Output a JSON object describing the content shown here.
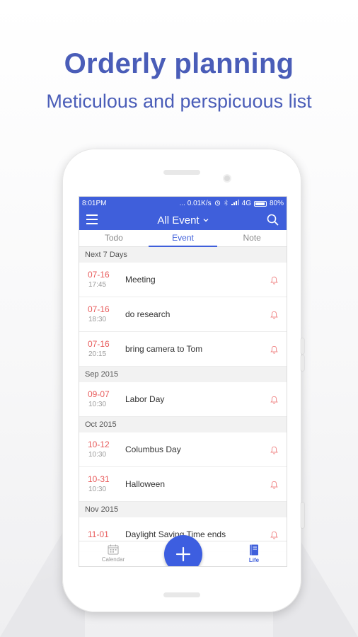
{
  "promo": {
    "headline": "Orderly planning",
    "subheadline": "Meticulous and perspicuous list"
  },
  "statusbar": {
    "time": "8:01PM",
    "speed": "... 0.01K/s",
    "network": "4G",
    "battery": "80%"
  },
  "appbar": {
    "title": "All Event"
  },
  "tabs": [
    {
      "label": "Todo"
    },
    {
      "label": "Event"
    },
    {
      "label": "Note"
    }
  ],
  "sections": [
    {
      "title": "Next 7 Days",
      "items": [
        {
          "date": "07-16",
          "time": "17:45",
          "name": "Meeting"
        },
        {
          "date": "07-16",
          "time": "18:30",
          "name": "do research"
        },
        {
          "date": "07-16",
          "time": "20:15",
          "name": "bring camera to Tom"
        }
      ]
    },
    {
      "title": "Sep 2015",
      "items": [
        {
          "date": "09-07",
          "time": "10:30",
          "name": "Labor Day"
        }
      ]
    },
    {
      "title": "Oct 2015",
      "items": [
        {
          "date": "10-12",
          "time": "10:30",
          "name": "Columbus Day"
        },
        {
          "date": "10-31",
          "time": "10:30",
          "name": "Halloween"
        }
      ]
    },
    {
      "title": "Nov 2015",
      "items": [
        {
          "date": "11-01",
          "time": "",
          "name": "Daylight Saving Time ends"
        }
      ]
    }
  ],
  "bottomnav": {
    "calendar_label": "Calendar",
    "life_label": "Life"
  },
  "icons": {
    "menu": "menu-icon",
    "search": "search-icon",
    "bell": "bell-icon",
    "add": "plus-icon",
    "calendar": "calendar-icon",
    "life": "notebook-icon"
  },
  "colors": {
    "accent": "#3f5fdb",
    "headline": "#4a5db8",
    "date_red": "#e85b5b"
  }
}
